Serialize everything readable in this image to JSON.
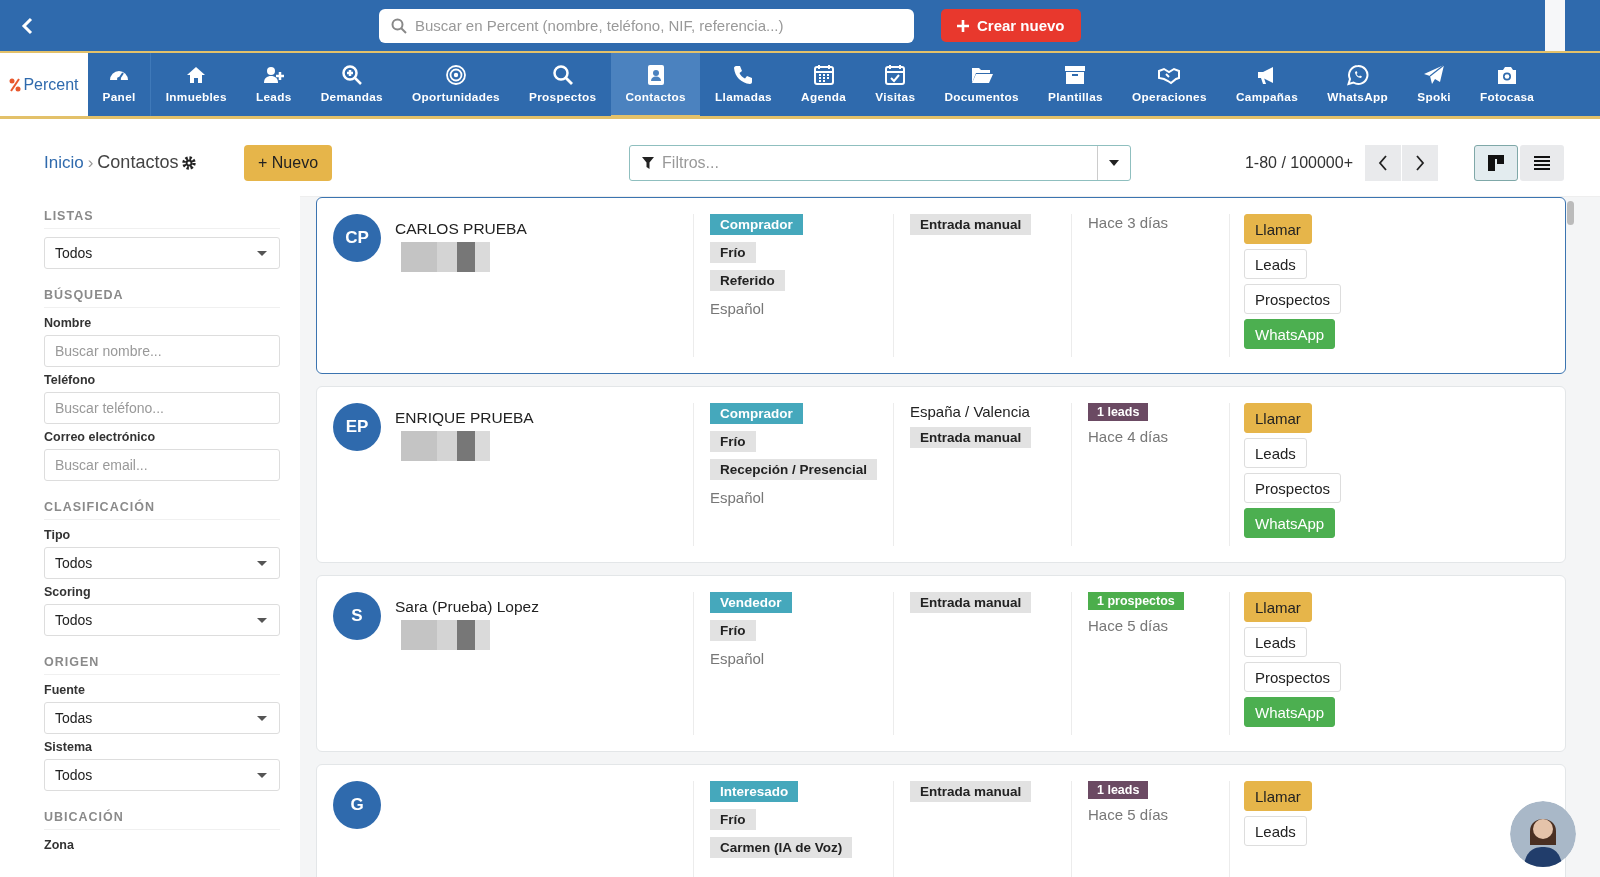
{
  "top_bar": {
    "search": {
      "placeholder": "Buscar en Percent (nombre, teléfono, NIF, referencia...)"
    },
    "create_button": "Crear nuevo"
  },
  "logo": "Percent",
  "nav": [
    {
      "label": "Panel",
      "selected": false
    },
    {
      "label": "Inmuebles",
      "selected": false
    },
    {
      "label": "Leads",
      "selected": false
    },
    {
      "label": "Demandas",
      "selected": false
    },
    {
      "label": "Oportunidades",
      "selected": false
    },
    {
      "label": "Prospectos",
      "selected": false
    },
    {
      "label": "Contactos",
      "selected": true
    },
    {
      "label": "Llamadas",
      "selected": false
    },
    {
      "label": "Agenda",
      "selected": false
    },
    {
      "label": "Visitas",
      "selected": false
    },
    {
      "label": "Documentos",
      "selected": false
    },
    {
      "label": "Plantillas",
      "selected": false
    },
    {
      "label": "Operaciones",
      "selected": false
    },
    {
      "label": "Campañas",
      "selected": false
    },
    {
      "label": "WhatsApp",
      "selected": false
    },
    {
      "label": "Spoki",
      "selected": false
    },
    {
      "label": "Fotocasa",
      "selected": false
    }
  ],
  "breadcrumb": {
    "home": "Inicio",
    "separator": "›",
    "current": "Contactos"
  },
  "new_button": "+ Nuevo",
  "filter": {
    "placeholder": "Filtros..."
  },
  "pagination": "1-80 / 100000+",
  "view_modes": [
    {
      "kind": "board",
      "selected": true
    },
    {
      "kind": "list",
      "selected": false
    }
  ],
  "sidebar": [
    {
      "title": "LISTAS",
      "fields": [
        {
          "kind": "select",
          "value": "Todos"
        }
      ]
    },
    {
      "title": "BÚSQUEDA",
      "fields": [
        {
          "kind": "text",
          "label": "Nombre",
          "placeholder": "Buscar nombre..."
        },
        {
          "kind": "text",
          "label": "Teléfono",
          "placeholder": "Buscar teléfono..."
        },
        {
          "kind": "text",
          "label": "Correo electrónico",
          "placeholder": "Buscar email..."
        }
      ]
    },
    {
      "title": "CLASIFICACIÓN",
      "fields": [
        {
          "kind": "select",
          "label": "Tipo",
          "value": "Todos"
        },
        {
          "kind": "select",
          "label": "Scoring",
          "value": "Todos"
        }
      ]
    },
    {
      "title": "ORIGEN",
      "fields": [
        {
          "kind": "select",
          "label": "Fuente",
          "value": "Todas"
        },
        {
          "kind": "select",
          "label": "Sistema",
          "value": "Todos"
        }
      ]
    },
    {
      "title": "UBICACIÓN",
      "fields": [
        {
          "kind": "label",
          "label": "Zona"
        }
      ]
    }
  ],
  "contacts": [
    {
      "initials": "CP",
      "name": "CARLOS PRUEBA",
      "selected": true,
      "phone_hidden": true,
      "tags": [
        {
          "text": "Comprador",
          "kind": "type"
        },
        {
          "text": "Frío",
          "kind": "plain"
        },
        {
          "text": "Referido",
          "kind": "plain"
        }
      ],
      "language": "Español",
      "origin": "Entrada manual",
      "when": "Hace 3 días",
      "actions": [
        {
          "text": "Llamar",
          "kind": "call"
        },
        {
          "text": "Leads",
          "kind": "outline"
        },
        {
          "text": "Prospectos",
          "kind": "outline"
        },
        {
          "text": "WhatsApp",
          "kind": "whatsapp"
        }
      ]
    },
    {
      "initials": "EP",
      "name": "ENRIQUE PRUEBA",
      "selected": false,
      "phone_hidden": true,
      "tags": [
        {
          "text": "Comprador",
          "kind": "type"
        },
        {
          "text": "Frío",
          "kind": "plain"
        },
        {
          "text": "Recepción / Presencial",
          "kind": "plain"
        }
      ],
      "language": "Español",
      "location": "España / Valencia",
      "origin": "Entrada manual",
      "count": {
        "text": "1 leads",
        "color": "#6b4a63"
      },
      "when": "Hace 4 días",
      "actions": [
        {
          "text": "Llamar",
          "kind": "call"
        },
        {
          "text": "Leads",
          "kind": "outline"
        },
        {
          "text": "Prospectos",
          "kind": "outline"
        },
        {
          "text": "WhatsApp",
          "kind": "whatsapp"
        }
      ]
    },
    {
      "initials": "S",
      "name": "Sara (Prueba) Lopez",
      "selected": false,
      "phone_hidden": true,
      "tags": [
        {
          "text": "Vendedor",
          "kind": "type"
        },
        {
          "text": "Frío",
          "kind": "plain"
        }
      ],
      "language": "Español",
      "origin": "Entrada manual",
      "count": {
        "text": "1 prospectos",
        "color": "#4cae4c"
      },
      "when": "Hace 5 días",
      "actions": [
        {
          "text": "Llamar",
          "kind": "call"
        },
        {
          "text": "Leads",
          "kind": "outline"
        },
        {
          "text": "Prospectos",
          "kind": "outline"
        },
        {
          "text": "WhatsApp",
          "kind": "whatsapp"
        }
      ]
    },
    {
      "initials": "G",
      "selected": false,
      "phone_hidden": false,
      "tags": [
        {
          "text": "Interesado",
          "kind": "type"
        },
        {
          "text": "Frío",
          "kind": "plain"
        },
        {
          "text": "Carmen (IA de Voz)",
          "kind": "plain"
        }
      ],
      "origin": "Entrada manual",
      "count": {
        "text": "1 leads",
        "color": "#6b4a63"
      },
      "when": "Hace 5 días",
      "actions": [
        {
          "text": "Llamar",
          "kind": "call"
        },
        {
          "text": "Leads",
          "kind": "outline"
        }
      ]
    }
  ]
}
